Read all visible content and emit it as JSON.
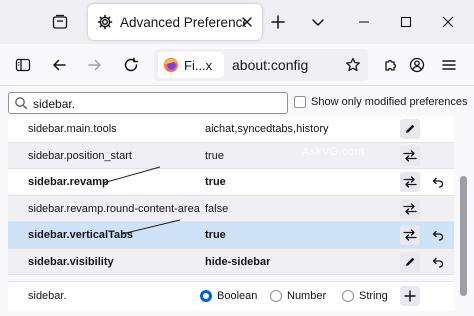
{
  "browser": {
    "tab_title": "Advanced Preferences",
    "identity_label": "Fi...x",
    "url": "about:config"
  },
  "search": {
    "value": "sidebar.",
    "show_modified_label": "Show only modified preferences",
    "show_modified_checked": false
  },
  "prefs": [
    {
      "name": "sidebar.main.tools",
      "value": "aichat,syncedtabs,history",
      "modified": false,
      "selected": false,
      "action": "edit-icon",
      "reset": false
    },
    {
      "name": "sidebar.position_start",
      "value": "true",
      "modified": false,
      "selected": false,
      "action": "toggle-icon",
      "reset": false
    },
    {
      "name": "sidebar.revamp",
      "value": "true",
      "modified": true,
      "selected": false,
      "action": "toggle-icon",
      "reset": true
    },
    {
      "name": "sidebar.revamp.round-content-area",
      "value": "false",
      "modified": false,
      "selected": false,
      "action": "toggle-icon",
      "reset": false
    },
    {
      "name": "sidebar.verticalTabs",
      "value": "true",
      "modified": true,
      "selected": true,
      "action": "toggle-icon",
      "reset": true
    },
    {
      "name": "sidebar.visibility",
      "value": "hide-sidebar",
      "modified": true,
      "selected": false,
      "action": "edit-icon",
      "reset": true
    }
  ],
  "new_pref": {
    "name": "sidebar.",
    "types": [
      "Boolean",
      "Number",
      "String"
    ],
    "selected_type": "Boolean"
  },
  "watermark": "AskVG.com",
  "colors": {
    "accent": "#0061e0",
    "selected_row": "#cfe3f8",
    "annotation_line": "#1a1a1a"
  }
}
